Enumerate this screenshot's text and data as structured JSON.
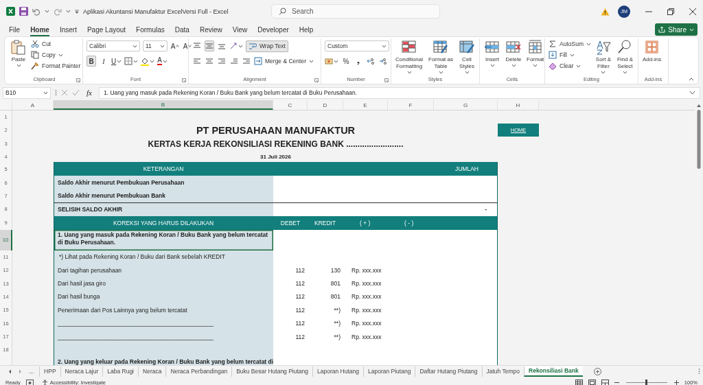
{
  "window": {
    "title": "Aplikasi Akuntansi Manufaktur ExcelVersi Full  -  Excel",
    "search_placeholder": "Search",
    "user_initials": "JM"
  },
  "menu": [
    {
      "label": "File",
      "selected": false
    },
    {
      "label": "Home",
      "selected": true
    },
    {
      "label": "Insert",
      "selected": false
    },
    {
      "label": "Page Layout",
      "selected": false
    },
    {
      "label": "Formulas",
      "selected": false
    },
    {
      "label": "Data",
      "selected": false
    },
    {
      "label": "Review",
      "selected": false
    },
    {
      "label": "View",
      "selected": false
    },
    {
      "label": "Developer",
      "selected": false
    },
    {
      "label": "Help",
      "selected": false
    }
  ],
  "share": "Share",
  "ribbon": [
    {
      "kind": "clipboard",
      "name": "Clipboard",
      "labels": [
        "Paste",
        "Cut",
        "Copy",
        "Format Painter"
      ]
    },
    {
      "kind": "font",
      "name": "Font",
      "font": "Calibri",
      "size": "11",
      "size_buttons": [
        "A",
        "A"
      ],
      "style_buttons": [
        {
          "label": "B",
          "selected": true
        },
        {
          "label": "I",
          "selected": false
        },
        {
          "label": "U",
          "selected": false
        }
      ],
      "color_button": "A"
    },
    {
      "kind": "alignment",
      "name": "Alignment",
      "vertical_align": [
        {
          "selected": false
        },
        {
          "selected": true
        },
        {
          "selected": false
        }
      ],
      "wrap_text": {
        "label": "Wrap Text",
        "on": true
      },
      "merge": "Merge & Center"
    },
    {
      "kind": "number",
      "name": "Number",
      "format": "Custom",
      "symbols": [
        "%",
        "❟"
      ]
    },
    {
      "kind": "styles",
      "name": "Styles",
      "labels": [
        "Conditional Formatting",
        "Format as Table",
        "Cell Styles"
      ]
    },
    {
      "kind": "cells",
      "name": "Cells",
      "labels": [
        "Insert",
        "Delete",
        "Format"
      ]
    },
    {
      "kind": "editing",
      "name": "Editing",
      "labels": [
        "AutoSum",
        "Fill",
        "Clear",
        "Sort & Filter",
        "Find & Select"
      ]
    },
    {
      "kind": "addins",
      "name": "Add-ins",
      "labels": [
        "Add-ins"
      ]
    }
  ],
  "formula_bar": {
    "name_box": "B10",
    "function_label": "fx",
    "formula": "1. Uang yang masuk pada Rekening Koran / Buku Bank yang belum tercatat di Buku Perusahaan."
  },
  "sheet": {
    "columns": [
      {
        "label": "A",
        "selected": false
      },
      {
        "label": "B",
        "selected": true
      },
      {
        "label": "C",
        "selected": false
      },
      {
        "label": "D",
        "selected": false
      },
      {
        "label": "E",
        "selected": false
      },
      {
        "label": "F",
        "selected": false
      },
      {
        "label": "G",
        "selected": false
      },
      {
        "label": "H",
        "selected": false
      }
    ],
    "rows": [
      {
        "number": "1",
        "kind": "blank",
        "selected": false,
        "cells": {}
      },
      {
        "number": "2",
        "kind": "title",
        "selected": false,
        "cells": {
          "B": "PT PERUSAHAAN MANUFAKTUR",
          "H": "HOME"
        }
      },
      {
        "number": "3",
        "kind": "subtitle",
        "selected": false,
        "cells": {
          "B": "KERTAS KERJA REKONSILIASI REKENING BANK ........................."
        }
      },
      {
        "number": "4",
        "kind": "date",
        "selected": false,
        "cells": {
          "B": "31 Juli 2026"
        }
      },
      {
        "number": "5",
        "kind": "header",
        "selected": false,
        "cells": {
          "B": "KETERANGAN",
          "G": "JUMLAH"
        }
      },
      {
        "number": "6",
        "kind": "label",
        "selected": false,
        "cells": {
          "B": "Saldo Akhir menurut Pembukuan Perusahaan"
        }
      },
      {
        "number": "7",
        "kind": "label",
        "selected": false,
        "cells": {
          "B": "Saldo Akhir menurut Pembukuan Bank"
        }
      },
      {
        "number": "8",
        "kind": "total",
        "selected": false,
        "cells": {
          "B": "SELISIH SALDO AKHIR",
          "G": "-"
        }
      },
      {
        "number": "9",
        "kind": "header",
        "selected": false,
        "cells": {
          "B": "KOREKSI YANG HARUS DILAKUKAN",
          "C": "DEBET",
          "D": "KREDIT",
          "E": "( + )",
          "F": "( - )"
        }
      },
      {
        "number": "10",
        "kind": "section",
        "selected": true,
        "cells": {
          "B": "1. Uang yang masuk pada Rekening Koran / Buku Bank yang belum tercatat di Buku Perusahaan."
        }
      },
      {
        "number": "11",
        "kind": "item",
        "selected": false,
        "cells": {
          "B": "*) Lihat pada Rekening Koran / Buku dari Bank sebelah KREDIT"
        }
      },
      {
        "number": "12",
        "kind": "item",
        "selected": false,
        "cells": {
          "B": "Dari tagihan perusahaan",
          "C": "112",
          "D": "130",
          "E": "Rp. xxx.xxx"
        }
      },
      {
        "number": "13",
        "kind": "item",
        "selected": false,
        "cells": {
          "B": "Dari hasil jasa giro",
          "C": "112",
          "D": "801",
          "E": "Rp. xxx.xxx"
        }
      },
      {
        "number": "14",
        "kind": "item",
        "selected": false,
        "cells": {
          "B": "Dari hasil bunga",
          "C": "112",
          "D": "801",
          "E": "Rp. xxx.xxx"
        }
      },
      {
        "number": "15",
        "kind": "item",
        "selected": false,
        "cells": {
          "B": "Penerimaan dari Pos Lainnya yang belum tercatat",
          "C": "112",
          "D": "**)",
          "E": "Rp. xxx.xxx"
        }
      },
      {
        "number": "16",
        "kind": "item",
        "selected": false,
        "cells": {
          "B": "________________________________________________",
          "C": "112",
          "D": "**)",
          "E": "Rp. xxx.xxx"
        }
      },
      {
        "number": "17",
        "kind": "item",
        "selected": false,
        "cells": {
          "B": "________________________________________________",
          "C": "112",
          "D": "**)",
          "E": "Rp. xxx.xxx"
        }
      },
      {
        "number": "18",
        "kind": "spacer",
        "selected": false,
        "cells": {}
      },
      {
        "kind": "section",
        "selected": false,
        "cells": {
          "B": "2. Uang yang keluar pada Rekening Koran / Buku Bank yang belum tercatat di"
        }
      }
    ]
  },
  "sheet_tabs": {
    "overflow": "...",
    "tabs": [
      {
        "label": "HPP",
        "selected": false
      },
      {
        "label": "Neraca Lajur",
        "selected": false
      },
      {
        "label": "Laba Rugi",
        "selected": false
      },
      {
        "label": "Neraca",
        "selected": false
      },
      {
        "label": "Neraca Perbandingan",
        "selected": false
      },
      {
        "label": "Buku Besar Hutang Piutang",
        "selected": false
      },
      {
        "label": "Laporan Hutang",
        "selected": false
      },
      {
        "label": "Laporan Piutang",
        "selected": false
      },
      {
        "label": "Daftar Hutang Piutang",
        "selected": false
      },
      {
        "label": "Jatuh Tempo",
        "selected": false
      },
      {
        "label": "Rekonsiliasi Bank",
        "selected": true
      }
    ]
  },
  "status_bar": {
    "mode": "Ready",
    "accessibility": "Accessibility: Investigate",
    "zoom": {
      "level": 0.5,
      "reading": "100%"
    }
  }
}
